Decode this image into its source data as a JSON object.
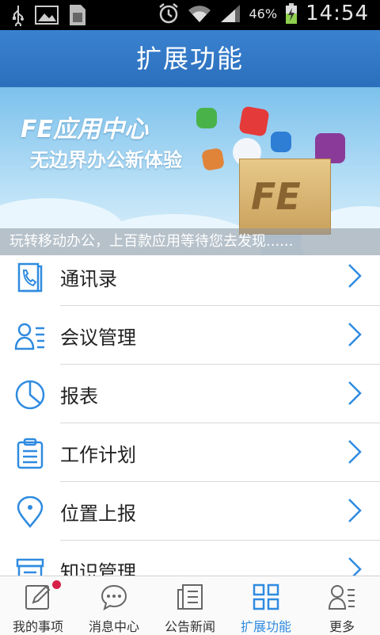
{
  "status_bar": {
    "battery_percent": "46%",
    "time": "14:54",
    "icons": [
      "usb-icon",
      "image-icon",
      "sim-icon",
      "alarm-icon",
      "wifi-icon",
      "signal-icon",
      "battery-charging-icon"
    ]
  },
  "header": {
    "title": "扩展功能"
  },
  "banner": {
    "title": "FE应用中心",
    "subtitle": "无边界办公新体验",
    "box_text": "FE",
    "caption": "玩转移动办公，上百款应用等待您去发现......"
  },
  "menu": {
    "items": [
      {
        "label": "通讯录",
        "icon": "address-book-icon"
      },
      {
        "label": "会议管理",
        "icon": "meeting-icon"
      },
      {
        "label": "报表",
        "icon": "pie-chart-icon"
      },
      {
        "label": "工作计划",
        "icon": "clipboard-icon"
      },
      {
        "label": "位置上报",
        "icon": "location-pin-icon"
      },
      {
        "label": "知识管理",
        "icon": "knowledge-icon"
      }
    ]
  },
  "bottom_nav": {
    "tabs": [
      {
        "label": "我的事项",
        "icon": "edit-icon",
        "badge": true
      },
      {
        "label": "消息中心",
        "icon": "chat-icon"
      },
      {
        "label": "公告新闻",
        "icon": "news-icon"
      },
      {
        "label": "扩展功能",
        "icon": "grid-icon",
        "active": true
      },
      {
        "label": "更多",
        "icon": "more-user-icon"
      }
    ]
  },
  "colors": {
    "brand_blue": "#2f8be0",
    "header_blue": "#3a82d0",
    "badge_red": "#d6204a"
  }
}
